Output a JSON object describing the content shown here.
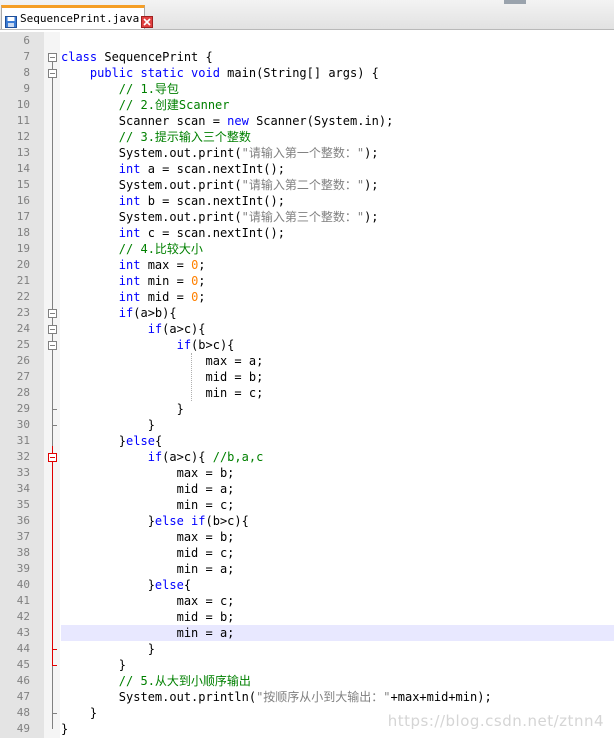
{
  "tab": {
    "label": "SequencePrint.java",
    "icon": "save-icon",
    "close_icon": "close-icon",
    "accent": "#f59e25"
  },
  "colors": {
    "keyword": "#0000ff",
    "comment": "#008000",
    "string": "#808080",
    "number": "#ff8000",
    "current_line": "#e8e8ff",
    "fold_active": "#e00000"
  },
  "editor": {
    "current_line": "43",
    "lines": [
      {
        "n": "6",
        "tokens": []
      },
      {
        "n": "7",
        "tokens": [
          {
            "t": "class",
            "c": "kw"
          },
          {
            "t": " SequencePrint {"
          }
        ]
      },
      {
        "n": "8",
        "tokens": [
          {
            "t": "    "
          },
          {
            "t": "public static void",
            "c": "kw"
          },
          {
            "t": " main(String[] args) {"
          }
        ]
      },
      {
        "n": "9",
        "tokens": [
          {
            "t": "        "
          },
          {
            "t": "// 1.导包",
            "c": "cm"
          }
        ]
      },
      {
        "n": "10",
        "tokens": [
          {
            "t": "        "
          },
          {
            "t": "// 2.创建Scanner",
            "c": "cm"
          }
        ]
      },
      {
        "n": "11",
        "tokens": [
          {
            "t": "        Scanner scan = "
          },
          {
            "t": "new",
            "c": "kw"
          },
          {
            "t": " Scanner(System.in);"
          }
        ]
      },
      {
        "n": "12",
        "tokens": [
          {
            "t": "        "
          },
          {
            "t": "// 3.提示输入三个整数",
            "c": "cm"
          }
        ]
      },
      {
        "n": "13",
        "tokens": [
          {
            "t": "        System.out.print("
          },
          {
            "t": "\"请输入第一个整数：\"",
            "c": "st"
          },
          {
            "t": ");"
          }
        ]
      },
      {
        "n": "14",
        "tokens": [
          {
            "t": "        "
          },
          {
            "t": "int",
            "c": "kw"
          },
          {
            "t": " a = scan.nextInt();"
          }
        ]
      },
      {
        "n": "15",
        "tokens": [
          {
            "t": "        System.out.print("
          },
          {
            "t": "\"请输入第二个整数：\"",
            "c": "st"
          },
          {
            "t": ");"
          }
        ]
      },
      {
        "n": "16",
        "tokens": [
          {
            "t": "        "
          },
          {
            "t": "int",
            "c": "kw"
          },
          {
            "t": " b = scan.nextInt();"
          }
        ]
      },
      {
        "n": "17",
        "tokens": [
          {
            "t": "        System.out.print("
          },
          {
            "t": "\"请输入第三个整数：\"",
            "c": "st"
          },
          {
            "t": ");"
          }
        ]
      },
      {
        "n": "18",
        "tokens": [
          {
            "t": "        "
          },
          {
            "t": "int",
            "c": "kw"
          },
          {
            "t": " c = scan.nextInt();"
          }
        ]
      },
      {
        "n": "19",
        "tokens": [
          {
            "t": "        "
          },
          {
            "t": "// 4.比较大小",
            "c": "cm"
          }
        ]
      },
      {
        "n": "20",
        "tokens": [
          {
            "t": "        "
          },
          {
            "t": "int",
            "c": "kw"
          },
          {
            "t": " max = "
          },
          {
            "t": "0",
            "c": "nm"
          },
          {
            "t": ";"
          }
        ]
      },
      {
        "n": "21",
        "tokens": [
          {
            "t": "        "
          },
          {
            "t": "int",
            "c": "kw"
          },
          {
            "t": " min = "
          },
          {
            "t": "0",
            "c": "nm"
          },
          {
            "t": ";"
          }
        ]
      },
      {
        "n": "22",
        "tokens": [
          {
            "t": "        "
          },
          {
            "t": "int",
            "c": "kw"
          },
          {
            "t": " mid = "
          },
          {
            "t": "0",
            "c": "nm"
          },
          {
            "t": ";"
          }
        ]
      },
      {
        "n": "23",
        "tokens": [
          {
            "t": "        "
          },
          {
            "t": "if",
            "c": "kw"
          },
          {
            "t": "(a>b){"
          }
        ]
      },
      {
        "n": "24",
        "tokens": [
          {
            "t": "            "
          },
          {
            "t": "if",
            "c": "kw"
          },
          {
            "t": "(a>c){"
          }
        ]
      },
      {
        "n": "25",
        "tokens": [
          {
            "t": "                "
          },
          {
            "t": "if",
            "c": "kw"
          },
          {
            "t": "(b>c){"
          }
        ]
      },
      {
        "n": "26",
        "tokens": [
          {
            "t": "                    max = a;"
          }
        ]
      },
      {
        "n": "27",
        "tokens": [
          {
            "t": "                    mid = b;"
          }
        ]
      },
      {
        "n": "28",
        "tokens": [
          {
            "t": "                    min = c;"
          }
        ]
      },
      {
        "n": "29",
        "tokens": [
          {
            "t": "                }"
          }
        ]
      },
      {
        "n": "30",
        "tokens": [
          {
            "t": "            }"
          }
        ]
      },
      {
        "n": "31",
        "tokens": [
          {
            "t": "        }"
          },
          {
            "t": "else",
            "c": "kw"
          },
          {
            "t": "{"
          }
        ]
      },
      {
        "n": "32",
        "tokens": [
          {
            "t": "            "
          },
          {
            "t": "if",
            "c": "kw"
          },
          {
            "t": "(a>c){ "
          },
          {
            "t": "//b,a,c",
            "c": "cm"
          }
        ]
      },
      {
        "n": "33",
        "tokens": [
          {
            "t": "                max = b;"
          }
        ]
      },
      {
        "n": "34",
        "tokens": [
          {
            "t": "                mid = a;"
          }
        ]
      },
      {
        "n": "35",
        "tokens": [
          {
            "t": "                min = c;"
          }
        ]
      },
      {
        "n": "36",
        "tokens": [
          {
            "t": "            }"
          },
          {
            "t": "else if",
            "c": "kw"
          },
          {
            "t": "(b>c){"
          }
        ]
      },
      {
        "n": "37",
        "tokens": [
          {
            "t": "                max = b;"
          }
        ]
      },
      {
        "n": "38",
        "tokens": [
          {
            "t": "                mid = c;"
          }
        ]
      },
      {
        "n": "39",
        "tokens": [
          {
            "t": "                min = a;"
          }
        ]
      },
      {
        "n": "40",
        "tokens": [
          {
            "t": "            }"
          },
          {
            "t": "else",
            "c": "kw"
          },
          {
            "t": "{"
          }
        ]
      },
      {
        "n": "41",
        "tokens": [
          {
            "t": "                max = c;"
          }
        ]
      },
      {
        "n": "42",
        "tokens": [
          {
            "t": "                mid = b;"
          }
        ]
      },
      {
        "n": "43",
        "tokens": [
          {
            "t": "                min = a;"
          }
        ]
      },
      {
        "n": "44",
        "tokens": [
          {
            "t": "            }"
          }
        ]
      },
      {
        "n": "45",
        "tokens": [
          {
            "t": "        }"
          }
        ]
      },
      {
        "n": "46",
        "tokens": [
          {
            "t": "        "
          },
          {
            "t": "// 5.从大到小顺序输出",
            "c": "cm"
          }
        ]
      },
      {
        "n": "47",
        "tokens": [
          {
            "t": "        System.out.println("
          },
          {
            "t": "\"按顺序从小到大输出：\"",
            "c": "st"
          },
          {
            "t": "+max+mid+min);"
          }
        ]
      },
      {
        "n": "48",
        "tokens": [
          {
            "t": "    }"
          }
        ]
      },
      {
        "n": "49",
        "tokens": [
          {
            "t": "}"
          }
        ]
      }
    ]
  },
  "watermark": "https://blog.csdn.net/ztnn4"
}
